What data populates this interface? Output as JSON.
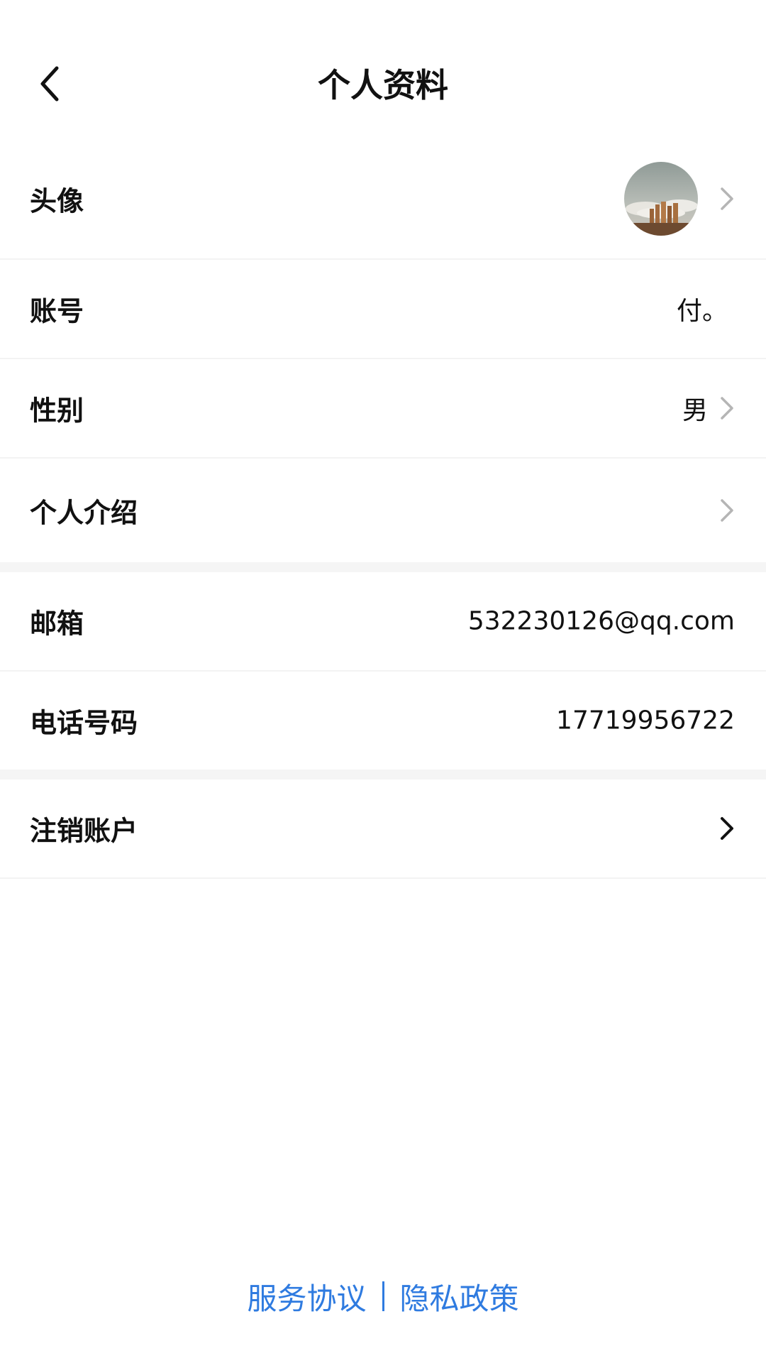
{
  "header": {
    "title": "个人资料"
  },
  "rows": {
    "avatar": {
      "label": "头像"
    },
    "account": {
      "label": "账号",
      "value": "付。"
    },
    "gender": {
      "label": "性别",
      "value": "男"
    },
    "intro": {
      "label": "个人介绍"
    },
    "email": {
      "label": "邮箱",
      "value": "532230126@qq.com"
    },
    "phone": {
      "label": "电话号码",
      "value": "17719956722"
    },
    "deactivate": {
      "label": "注销账户"
    }
  },
  "footer": {
    "service_agreement": "服务协议",
    "privacy_policy": "隐私政策"
  },
  "colors": {
    "link": "#2f7be0",
    "chevron_light": "#b5b5b5",
    "chevron_dark": "#111111",
    "section_gap": "#f5f5f5"
  },
  "icons": {
    "back": "chevron-left-icon",
    "row_arrow": "chevron-right-icon"
  }
}
